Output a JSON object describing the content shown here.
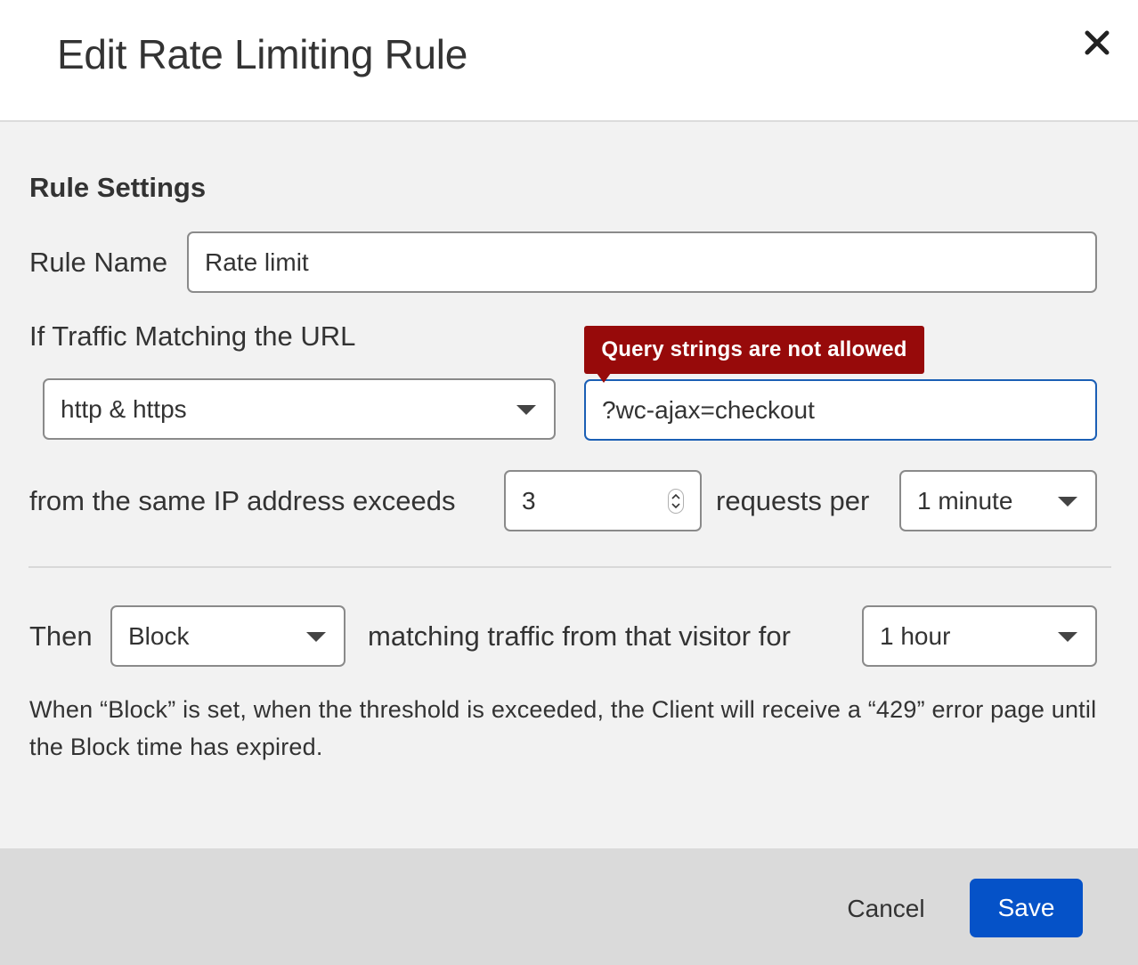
{
  "dialog": {
    "title": "Edit Rate Limiting Rule"
  },
  "section": {
    "title": "Rule Settings"
  },
  "rule_name": {
    "label": "Rule Name",
    "value": "Rate limit"
  },
  "url_match": {
    "label": "If Traffic Matching the URL",
    "protocol_selected": "http & https",
    "url_value": "?wc-ajax=checkout",
    "error_tooltip": "Query strings are not allowed"
  },
  "threshold": {
    "label_prefix": "from the same IP address exceeds",
    "requests_value": "3",
    "label_mid": "requests per",
    "period_selected": "1 minute"
  },
  "action": {
    "label_prefix": "Then",
    "action_selected": "Block",
    "label_mid": "matching traffic from that visitor for",
    "duration_selected": "1 hour"
  },
  "help": {
    "text": "When “Block” is set, when the threshold is exceeded, the Client will receive a “429” error page until the Block time has expired."
  },
  "footer": {
    "cancel_label": "Cancel",
    "save_label": "Save"
  },
  "colors": {
    "save_button": "#0552c8",
    "error_tooltip": "#970a0a",
    "focus_border": "#1b5fb5"
  }
}
